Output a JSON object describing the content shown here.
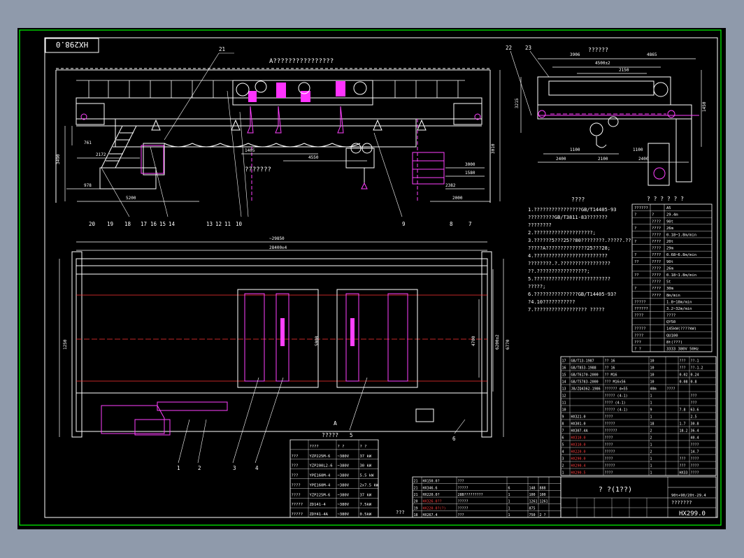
{
  "drawing": {
    "number": "HX298.0",
    "number_rotated": "HX298.0",
    "view_a_title": "A????????????????",
    "side_view_title": "??????",
    "trolley_label": "???????",
    "section_a_label": "?????",
    "view_arrow_label": "A"
  },
  "callouts": {
    "top": [
      "21",
      "22",
      "23"
    ],
    "mid": [
      "13",
      "12",
      "11",
      "10",
      "9"
    ],
    "left": [
      "20",
      "19",
      "18",
      "17",
      "16",
      "15",
      "14"
    ],
    "right": [
      "8",
      "7"
    ],
    "bottom": [
      "1",
      "2",
      "3",
      "4",
      "5",
      "6"
    ]
  },
  "dimensions": {
    "front": [
      "761",
      "2172",
      "978",
      "3490",
      "5200",
      "1405",
      "4550",
      "3000",
      "1580",
      "2382",
      "3010",
      "2000",
      "2000",
      "3210",
      "1450",
      "590"
    ],
    "plan": [
      "~29850",
      "28400±4",
      "4700",
      "5000",
      "6200±2",
      "6770",
      "1250"
    ],
    "side": [
      "3906",
      "4865",
      "4500±2",
      "2150",
      "1100",
      "1100",
      "2400",
      "2100",
      "2400",
      "3215",
      "1450"
    ]
  },
  "tech": {
    "heading": "????",
    "notes": [
      "1.????????????????GB/T14405-93",
      "  ?????????GB/T3811-83???????",
      "  ????????",
      "2.????????????????????;",
      "3.??????5???25??80????????.?????.??",
      "  ?????A??????????????25???28;",
      "4.?????????????????????????",
      "  ????????.?.?????????????????",
      "  ??.?????????????????;",
      "5.??????????????????????????",
      "  ?????;",
      "6.???????????????GB/T14405-93?",
      "  ?4.10???????????",
      "7.??????????????????        ?????"
    ]
  },
  "params": {
    "title": "? ? ? ? ? ?",
    "rows": [
      [
        "??????",
        "",
        "A5"
      ],
      [
        "?",
        "?",
        "29.4m"
      ],
      [
        "",
        "????",
        "90t"
      ],
      [
        "?",
        "????",
        "26m"
      ],
      [
        "",
        "????",
        "0.18~1.8m/min"
      ],
      [
        "?",
        "????",
        "20t"
      ],
      [
        "",
        "????",
        "29m"
      ],
      [
        "?",
        "????",
        "0.68~6.8m/min"
      ],
      [
        "??",
        "????",
        "90t"
      ],
      [
        "",
        "????",
        "26m"
      ],
      [
        "??",
        "????",
        "0.18~1.8m/min"
      ],
      [
        "",
        "????",
        "5t"
      ],
      [
        "?",
        "????",
        "30m"
      ],
      [
        "",
        "????",
        "8m/min"
      ],
      [
        "?????",
        "",
        "1.8~18m/min"
      ],
      [
        "??????",
        "",
        "3.2~32m/min"
      ],
      [
        "????",
        "",
        "????"
      ],
      [
        "",
        "",
        "QY50"
      ],
      [
        "?????",
        "",
        "145kW(????kW)"
      ],
      [
        "????",
        "",
        "QU100"
      ],
      [
        "???",
        "",
        "8t(???)"
      ],
      [
        "?  ?",
        "",
        "3333 380V 50Hz"
      ]
    ]
  },
  "motors": {
    "header": [
      "????",
      "?  ?",
      "?  ?"
    ],
    "rows": [
      [
        "???",
        "YZP225M-6",
        "~380V",
        "37 kW"
      ],
      [
        "???",
        "YZP200L2-6",
        "~380V",
        "30 kW"
      ],
      [
        "???",
        "YPE160M-4",
        "~380V",
        "5.5 kW"
      ],
      [
        "????",
        "YPE160M-4",
        "~380V",
        "2x7.5 kW"
      ],
      [
        "????",
        "YZP225M-6",
        "~380V",
        "37 kW"
      ],
      [
        "?????",
        "ZD141-4",
        "~380V",
        "7.5kW"
      ],
      [
        "?????",
        "ZDY41-4A",
        "~380V",
        "0.5kW"
      ]
    ]
  },
  "bom": {
    "rows": [
      [
        "17",
        "GB/T13-1987",
        "??  16",
        "10",
        "",
        "???",
        "??-1"
      ],
      [
        "16",
        "GB/T853-1988",
        "??  16",
        "10",
        "",
        "???",
        "??-1.2"
      ],
      [
        "15",
        "GB/T6170-2000",
        "??  M16",
        "10",
        "",
        "0.02",
        "0.24"
      ],
      [
        "14",
        "GB/T5783-2000",
        "???  M16x56",
        "10",
        "",
        "0.08",
        "0.8"
      ],
      [
        "13",
        "JB/ZQ4362-1986",
        "??????  d=55",
        "40m",
        "????",
        "",
        ""
      ],
      [
        "12",
        "",
        "?????  (4-1)",
        "1",
        "",
        "",
        "???"
      ],
      [
        "11",
        "",
        "????  (4-1)",
        "1",
        "",
        "",
        "???"
      ],
      [
        "10",
        "",
        "?????  (4-1)",
        "9",
        "",
        "7.8",
        "63.6"
      ],
      [
        "9",
        "HX321.0",
        "????",
        "1",
        "",
        "",
        "2.5"
      ],
      [
        "8",
        "HX301.0",
        "?????",
        "18",
        "",
        "1.7",
        "30.8"
      ],
      [
        "7",
        "HX307.4A",
        "??????",
        "2",
        "",
        "18.2",
        "36.4"
      ],
      [
        "6",
        "HX310.0",
        "????",
        "2",
        "",
        "",
        "40.4"
      ],
      [
        "5",
        "HX310.0",
        "????",
        "1",
        "",
        "",
        "????"
      ],
      [
        "4",
        "HX220.0",
        "?????",
        "2",
        "",
        "",
        "14.7"
      ],
      [
        "3",
        "HX290.0",
        "????",
        "1",
        "",
        "???",
        "????"
      ],
      [
        "2",
        "HX290.4",
        "?????",
        "1",
        "",
        "???",
        "????"
      ],
      [
        "1",
        "HX290.5",
        "????",
        "1",
        "",
        "HX33",
        "????"
      ]
    ],
    "footer_left": [
      "21",
      "20",
      "19",
      "18"
    ],
    "footer_rows": [
      [
        "21",
        "HX150.0?",
        "???",
        "",
        "",
        ""
      ],
      [
        "21",
        "HX346.6",
        "?????",
        "6",
        "148",
        "888"
      ],
      [
        "21",
        "HX220.0?",
        "28B?????????",
        "1",
        "100",
        "100"
      ],
      [
        "20",
        "HX326.0??",
        "?????",
        "1",
        "1261",
        "1261"
      ],
      [
        "19",
        "HX220.0?(?)",
        "?????",
        "1",
        "875",
        ""
      ],
      [
        "18",
        "HX267.4",
        "???",
        "1",
        "750",
        "2 ?"
      ]
    ],
    "header": [
      "?",
      "?",
      "?",
      "?",
      "?",
      "?",
      "?"
    ]
  },
  "title_block": {
    "name": "? ?(1??)",
    "scale_note": "90t+90/20t-29.4",
    "subtitle": "???????",
    "drawing_no": "HX299.0",
    "company": "???"
  }
}
